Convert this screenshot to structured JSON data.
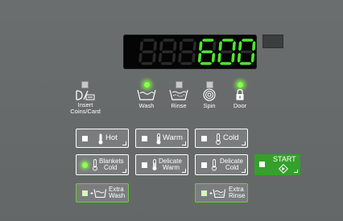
{
  "display": {
    "digits": [
      "8",
      "8",
      "8",
      "6",
      "0",
      "0"
    ],
    "lit": [
      false,
      false,
      false,
      true,
      true,
      true
    ],
    "lit_color": "#4fe62e",
    "unlit_color": "#2a2a2a"
  },
  "indicators": [
    {
      "key": "insert",
      "label_line1": "Insert",
      "label_line2": "Coins/Card",
      "icon": "coin-card-icon",
      "lit": false
    },
    {
      "key": "wash",
      "label_line1": "Wash",
      "label_line2": "",
      "icon": "wash-tub-icon",
      "lit": true
    },
    {
      "key": "rinse",
      "label_line1": "Rinse",
      "label_line2": "",
      "icon": "rinse-tub-icon",
      "lit": false
    },
    {
      "key": "spin",
      "label_line1": "Spin",
      "label_line2": "",
      "icon": "spin-spiral-icon",
      "lit": false
    },
    {
      "key": "door",
      "label_line1": "Door",
      "label_line2": "",
      "icon": "lock-icon",
      "lit": true
    }
  ],
  "buttons": {
    "hot": {
      "label": "Hot",
      "active": false
    },
    "warm": {
      "label": "Warm",
      "active": false
    },
    "cold": {
      "label": "Cold",
      "active": false
    },
    "blankets_cold": {
      "line1": "Blankets",
      "line2": "Cold",
      "active": true
    },
    "delicate_warm": {
      "line1": "Delicate",
      "line2": "Warm",
      "active": false
    },
    "delicate_cold": {
      "line1": "Delicate",
      "line2": "Cold",
      "active": false
    },
    "start": {
      "label": "START"
    },
    "extra_wash": {
      "line1": "Extra",
      "line2": "Wash"
    },
    "extra_rinse": {
      "line1": "Extra",
      "line2": "Rinse"
    }
  },
  "colors": {
    "panel": "#676a6a",
    "led_on": "#8cff50",
    "start_green": "#33a12a",
    "extra_border": "#6ec93d"
  }
}
